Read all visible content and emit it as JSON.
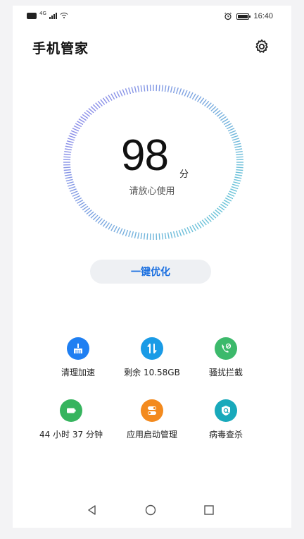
{
  "status_bar": {
    "network_badge": "4G",
    "time": "16:40"
  },
  "header": {
    "title": "手机管家",
    "settings_icon": "gear-icon"
  },
  "score": {
    "value": "98",
    "unit": "分",
    "status": "请放心使用"
  },
  "optimize_button": {
    "label": "一键优化"
  },
  "tools": [
    {
      "label": "清理加速",
      "icon": "broom-icon",
      "color": "#1f7ff2"
    },
    {
      "label": "剩余 10.58GB",
      "icon": "data-arrows-icon",
      "color": "#1a9be6"
    },
    {
      "label": "骚扰拦截",
      "icon": "phone-block-icon",
      "color": "#3cb96b"
    },
    {
      "label": "44 小时 37 分钟",
      "icon": "battery-icon",
      "color": "#36b45e"
    },
    {
      "label": "应用启动管理",
      "icon": "toggle-icon",
      "color": "#f38a1e"
    },
    {
      "label": "病毒查杀",
      "icon": "shield-search-icon",
      "color": "#18a9bb"
    }
  ],
  "nav": {
    "back_icon": "back-triangle-icon",
    "home_icon": "home-circle-icon",
    "recents_icon": "recents-square-icon"
  },
  "colors": {
    "accent": "#1a6fe0",
    "ring_start": "#8b8ee8",
    "ring_end": "#6ac3d8"
  }
}
